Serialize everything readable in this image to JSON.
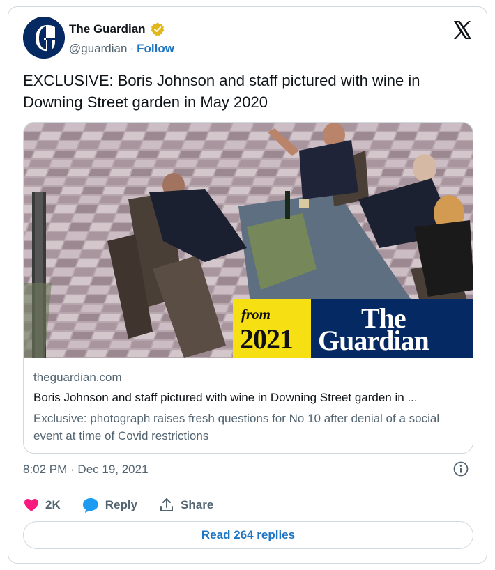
{
  "author": {
    "name": "The Guardian",
    "handle": "@guardian",
    "separator": "·",
    "follow_label": "Follow",
    "verified_color": "#e2b719"
  },
  "tweet": {
    "text": "EXCLUSIVE: Boris Johnson and staff pictured with wine in Downing Street garden in May 2020"
  },
  "link_card": {
    "image_overlay": {
      "from": "from",
      "year": "2021",
      "the": "The",
      "guardian": "Guardian"
    },
    "domain": "theguardian.com",
    "title": "Boris Johnson and staff pictured with wine in Downing Street garden in ...",
    "description": "Exclusive: photograph raises fresh questions for No 10 after denial of a social event at time of Covid restrictions"
  },
  "meta": {
    "timestamp": "8:02 PM · Dec 19, 2021"
  },
  "actions": {
    "like_count": "2K",
    "reply_label": "Reply",
    "share_label": "Share"
  },
  "read_replies_label": "Read 264 replies",
  "colors": {
    "guardian_blue": "#052962",
    "guardian_yellow": "#f6e013",
    "link_blue": "#1d75c4",
    "like_pink": "#f91880",
    "reply_blue": "#1d9bf0"
  },
  "icons": [
    "guardian-logo-icon",
    "verified-badge-icon",
    "x-logo-icon",
    "info-icon",
    "heart-icon",
    "reply-bubble-icon",
    "share-icon"
  ]
}
